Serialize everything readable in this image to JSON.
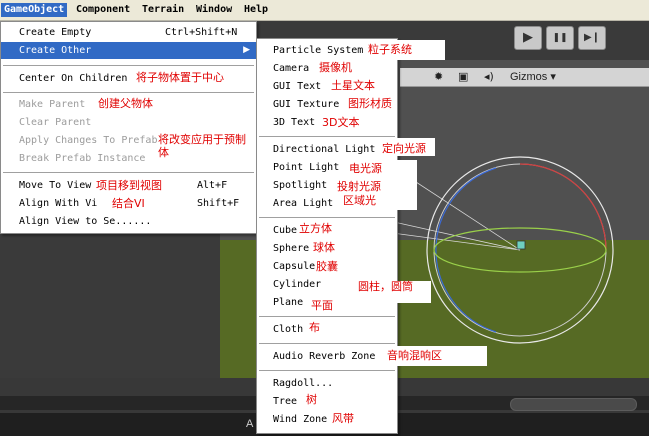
{
  "menubar": {
    "items": [
      "GameObject",
      "Component",
      "Terrain",
      "Window",
      "Help"
    ]
  },
  "gameobject_menu": {
    "create_empty": "Create Empty",
    "create_empty_shortcut": "Ctrl+Shift+N",
    "create_other": "Create Other",
    "center_on_children": "Center On Children",
    "make_parent": "Make Parent",
    "clear_parent": "Clear Parent",
    "apply_changes": "Apply Changes To Prefab",
    "break_prefab": "Break Prefab Instance",
    "move_to_view": "Move To View",
    "move_to_view_shortcut": "Alt+F",
    "align_with_view": "Align With Vi",
    "align_with_view_shortcut": "Shift+F",
    "align_view_to_selected": "Align View to Se......"
  },
  "create_other_menu": {
    "particle_system": "Particle System",
    "camera": "Camera",
    "gui_text": "GUI Text",
    "gui_texture": "GUI Texture",
    "text_3d": "3D Text",
    "directional_light": "Directional Light",
    "point_light": "Point Light",
    "spotlight": "Spotlight",
    "area_light": "Area Light",
    "cube": "Cube",
    "sphere": "Sphere",
    "capsule": "Capsule",
    "cylinder": "Cylinder",
    "plane": "Plane",
    "cloth": "Cloth",
    "audio_reverb_zone": "Audio Reverb Zone",
    "ragdoll": "Ragdoll...",
    "tree": "Tree",
    "wind_zone": "Wind Zone"
  },
  "annotations": {
    "center_on_children": "将子物体置于中心",
    "make_parent": "创建父物体",
    "apply_changes_1": "将改变应用于预制",
    "apply_changes_2": "体",
    "move_to_view": "项目移到视图",
    "align_with_view": "结合VI",
    "particle_system": "粒子系统",
    "camera": "摄像机",
    "gui_text": "土星文本",
    "gui_texture": "图形材质",
    "text_3d": "3D文本",
    "directional_light": "定向光源",
    "point_light": "电光源",
    "spotlight": "投射光源",
    "area_light": "区域光",
    "cube": "立方体",
    "sphere": "球体",
    "capsule": "胶囊",
    "cylinder": "圆柱，圆筒",
    "plane": "平面",
    "cloth": "布",
    "audio_reverb_zone": "音响混响区",
    "tree": "树",
    "wind_zone": "风带"
  },
  "scene_toolbar": {
    "gizmos_label": "Gizmos",
    "gizmos_caret": "▾",
    "sun_icon": "✹",
    "image_icon": "▣",
    "audio_icon": "◂)"
  },
  "playback": {
    "play_glyph": "▶",
    "pause_glyph": "❚❚",
    "step_glyph": "▶❙"
  },
  "bottom": {
    "a_label": "A"
  },
  "colors": {
    "menu_highlight": "#316ac5",
    "annotation_red": "#e00000",
    "ground_green": "#566a24"
  }
}
